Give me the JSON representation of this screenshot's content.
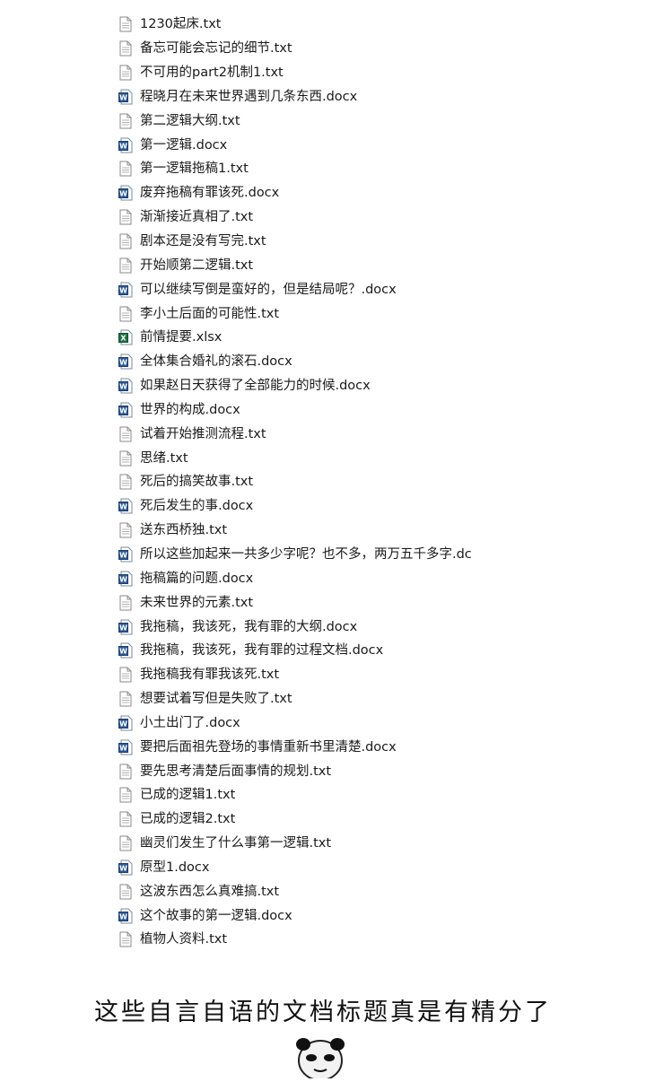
{
  "files": [
    {
      "name": "1230起床.txt",
      "type": "txt"
    },
    {
      "name": "备忘可能会忘记的细节.txt",
      "type": "txt"
    },
    {
      "name": "不可用的part2机制1.txt",
      "type": "txt"
    },
    {
      "name": "程晓月在未来世界遇到几条东西.docx",
      "type": "docx"
    },
    {
      "name": "第二逻辑大纲.txt",
      "type": "txt"
    },
    {
      "name": "第一逻辑.docx",
      "type": "docx"
    },
    {
      "name": "第一逻辑拖稿1.txt",
      "type": "txt"
    },
    {
      "name": "废弃拖稿有罪该死.docx",
      "type": "docx"
    },
    {
      "name": "渐渐接近真相了.txt",
      "type": "txt"
    },
    {
      "name": "剧本还是没有写完.txt",
      "type": "txt"
    },
    {
      "name": "开始顺第二逻辑.txt",
      "type": "txt"
    },
    {
      "name": "可以继续写倒是蛮好的，但是结局呢？.docx",
      "type": "docx"
    },
    {
      "name": "李小土后面的可能性.txt",
      "type": "txt"
    },
    {
      "name": "前情提要.xlsx",
      "type": "xlsx"
    },
    {
      "name": "全体集合婚礼的滚石.docx",
      "type": "docx"
    },
    {
      "name": "如果赵日天获得了全部能力的时候.docx",
      "type": "docx"
    },
    {
      "name": "世界的构成.docx",
      "type": "docx"
    },
    {
      "name": "试着开始推测流程.txt",
      "type": "txt"
    },
    {
      "name": "思绪.txt",
      "type": "txt"
    },
    {
      "name": "死后的搞笑故事.txt",
      "type": "txt"
    },
    {
      "name": "死后发生的事.docx",
      "type": "docx"
    },
    {
      "name": "送东西桥独.txt",
      "type": "txt"
    },
    {
      "name": "所以这些加起来一共多少字呢？也不多，两万五千多字.dc",
      "type": "docx"
    },
    {
      "name": "拖稿篇的问题.docx",
      "type": "docx"
    },
    {
      "name": "未来世界的元素.txt",
      "type": "txt"
    },
    {
      "name": "我拖稿，我该死，我有罪的大纲.docx",
      "type": "docx"
    },
    {
      "name": "我拖稿，我该死，我有罪的过程文档.docx",
      "type": "docx"
    },
    {
      "name": "我拖稿我有罪我该死.txt",
      "type": "txt"
    },
    {
      "name": "想要试着写但是失败了.txt",
      "type": "txt"
    },
    {
      "name": "小土出门了.docx",
      "type": "docx"
    },
    {
      "name": "要把后面祖先登场的事情重新书里清楚.docx",
      "type": "docx"
    },
    {
      "name": "要先思考清楚后面事情的规划.txt",
      "type": "txt"
    },
    {
      "name": "已成的逻辑1.txt",
      "type": "txt"
    },
    {
      "name": "已成的逻辑2.txt",
      "type": "txt"
    },
    {
      "name": "幽灵们发生了什么事第一逻辑.txt",
      "type": "txt"
    },
    {
      "name": "原型1.docx",
      "type": "docx"
    },
    {
      "name": "这波东西怎么真难搞.txt",
      "type": "txt"
    },
    {
      "name": "这个故事的第一逻辑.docx",
      "type": "docx"
    },
    {
      "name": "植物人资料.txt",
      "type": "txt"
    }
  ],
  "caption": "这些自言自语的文档标题真是有精分了",
  "meme": {
    "icon": "panda-face-meme-icon"
  },
  "colors": {
    "word": "#2b5797",
    "excel": "#1e7145",
    "selection_line": "#9ec3e8"
  }
}
